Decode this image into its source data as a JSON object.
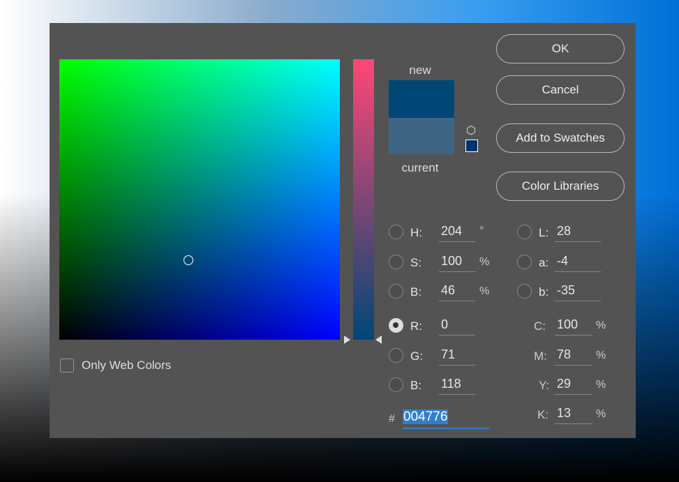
{
  "preview": {
    "new_label": "new",
    "current_label": "current",
    "new_color": "#004776",
    "current_color": "#3f6585"
  },
  "buttons": {
    "ok": "OK",
    "cancel": "Cancel",
    "add_swatches": "Add to Swatches",
    "color_libraries": "Color Libraries"
  },
  "only_web_colors": {
    "label": "Only Web Colors",
    "checked": false
  },
  "selected_channel": "R",
  "hsb": [
    {
      "label": "H:",
      "value": "204",
      "unit": "°"
    },
    {
      "label": "S:",
      "value": "100",
      "unit": "%"
    },
    {
      "label": "B:",
      "value": "46",
      "unit": "%"
    }
  ],
  "rgb": [
    {
      "label": "R:",
      "value": "0"
    },
    {
      "label": "G:",
      "value": "71"
    },
    {
      "label": "B:",
      "value": "118"
    }
  ],
  "lab": [
    {
      "label": "L:",
      "value": "28"
    },
    {
      "label": "a:",
      "value": "-4"
    },
    {
      "label": "b:",
      "value": "-35"
    }
  ],
  "cmyk": [
    {
      "label": "C:",
      "value": "100",
      "unit": "%"
    },
    {
      "label": "M:",
      "value": "78",
      "unit": "%"
    },
    {
      "label": "Y:",
      "value": "29",
      "unit": "%"
    },
    {
      "label": "K:",
      "value": "13",
      "unit": "%"
    }
  ],
  "hex": {
    "label": "#",
    "value": "004776"
  }
}
